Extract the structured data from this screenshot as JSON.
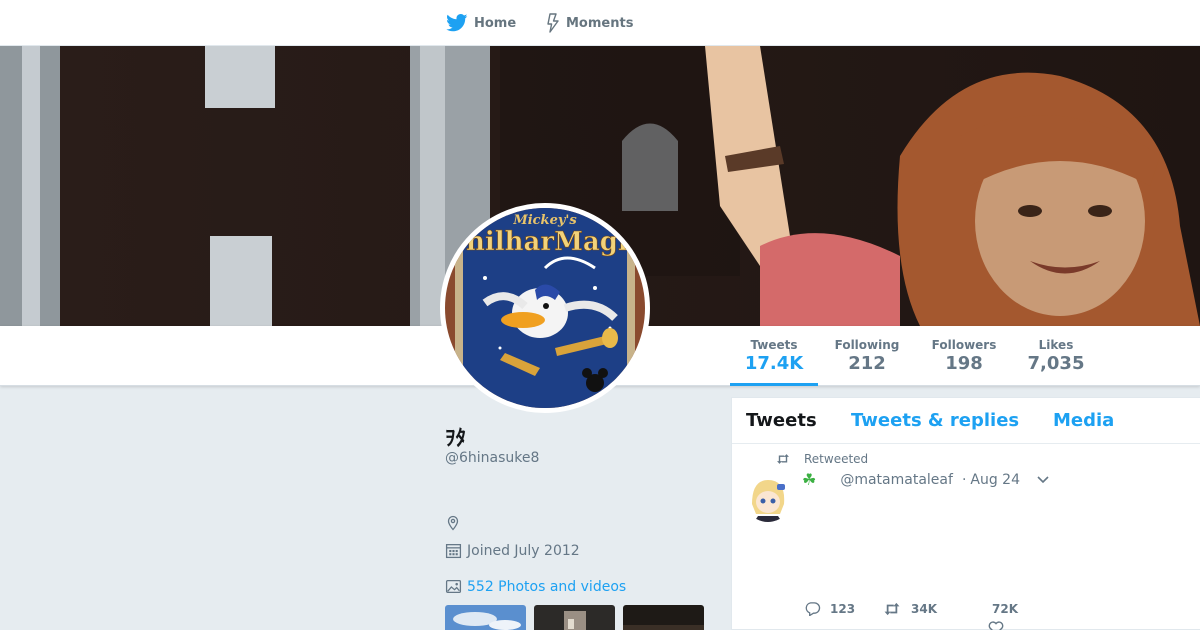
{
  "topnav": {
    "home_label": "Home",
    "moments_label": "Moments",
    "home_icon": "bird-icon",
    "moments_icon": "lightning-icon"
  },
  "colors": {
    "accent": "#1da1f2",
    "page_bg": "#e6ecf0",
    "secondary_text": "#657786"
  },
  "profile": {
    "display_name": "ｦﾀ",
    "handle": "@6hinasuke8",
    "joined": "Joined July 2012",
    "photos_label": "552 Photos and videos",
    "avatar_title_small": "Mickey's",
    "avatar_title": "PhilharMagic"
  },
  "stats": {
    "tweets_label": "Tweets",
    "tweets_value": "17.4K",
    "following_label": "Following",
    "following_value": "212",
    "followers_label": "Followers",
    "followers_value": "198",
    "likes_label": "Likes",
    "likes_value": "7,035"
  },
  "timeline": {
    "tabs": [
      {
        "label": "Tweets",
        "active": true
      },
      {
        "label": "Tweets & replies",
        "active": false
      },
      {
        "label": "Media",
        "active": false
      }
    ],
    "tweet": {
      "retweet_label": "Retweeted",
      "author_emoji": "☘",
      "handle": "@matamataleaf",
      "separator": "·",
      "date": "Aug 24",
      "reply_count": "123",
      "retweet_count": "34K",
      "like_count": "72K"
    }
  }
}
